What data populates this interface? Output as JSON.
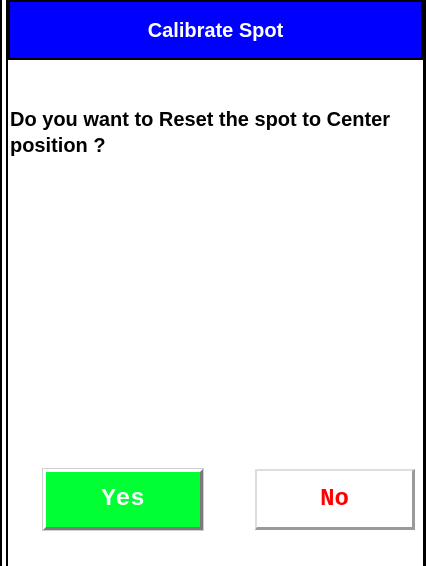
{
  "dialog": {
    "title": "Calibrate Spot",
    "message": "Do you want to Reset the spot to Center position ?"
  },
  "buttons": {
    "yes_label": "Yes",
    "no_label": "No"
  },
  "colors": {
    "title_bar": "#0000ff",
    "title_text": "#ffffff",
    "yes_button_bg": "#00ff33",
    "yes_button_text": "#ffffff",
    "no_button_bg": "#ffffff",
    "no_button_text": "#ff0000"
  }
}
